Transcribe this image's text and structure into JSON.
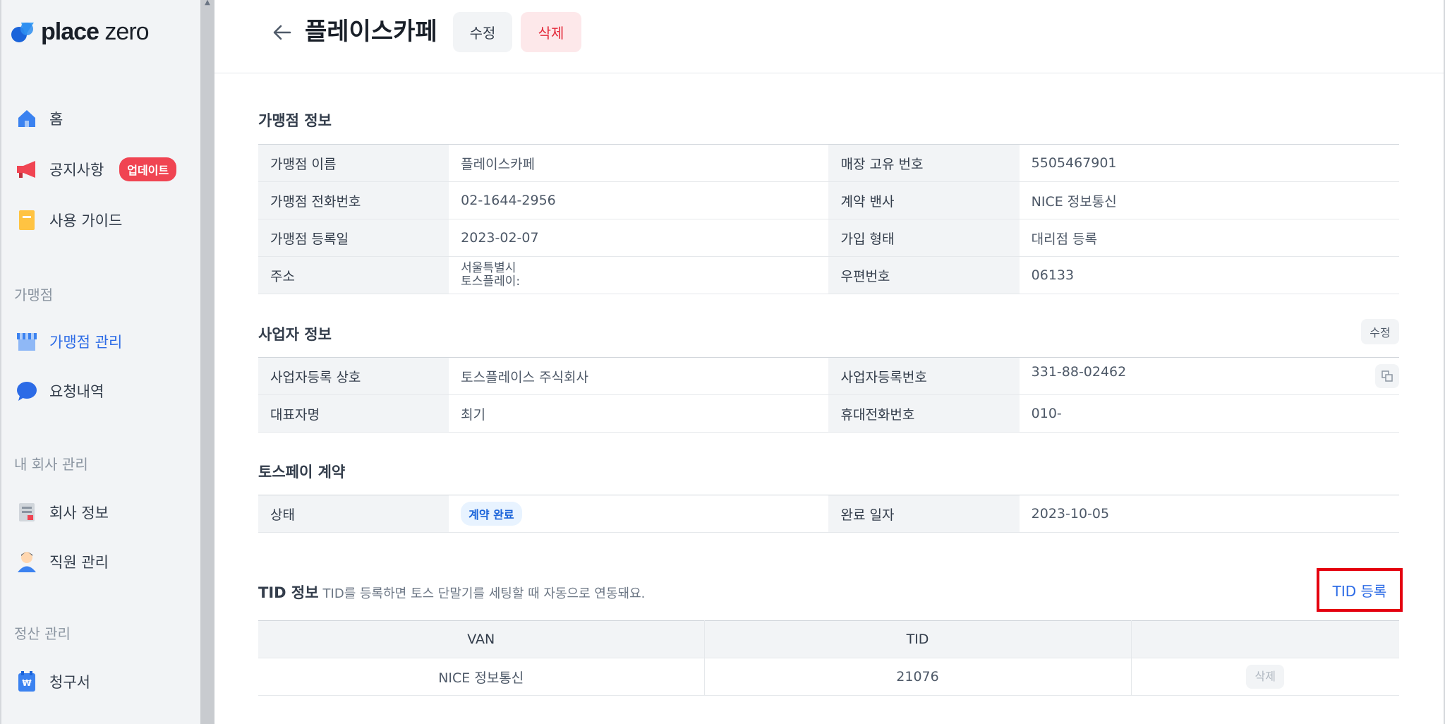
{
  "brand": {
    "logo_bold": "place",
    "logo_light": "zero"
  },
  "sidebar": {
    "items": [
      {
        "label": "홈",
        "icon": "home-icon"
      },
      {
        "label": "공지사항",
        "icon": "megaphone-icon",
        "badge": "업데이트"
      },
      {
        "label": "사용 가이드",
        "icon": "guide-book-icon"
      }
    ],
    "section_franchise": "가맹점",
    "franchise_items": [
      {
        "label": "가맹점 관리",
        "icon": "store-icon",
        "active": true
      },
      {
        "label": "요청내역",
        "icon": "chat-bubble-icon"
      }
    ],
    "section_company": "내 회사 관리",
    "company_items": [
      {
        "label": "회사 정보",
        "icon": "company-doc-icon"
      },
      {
        "label": "직원 관리",
        "icon": "staff-person-icon"
      }
    ],
    "section_settlement": "정산 관리",
    "settlement_items": [
      {
        "label": "청구서",
        "icon": "invoice-icon"
      }
    ]
  },
  "header": {
    "title": "플레이스카페",
    "edit_label": "수정",
    "delete_label": "삭제"
  },
  "store_info": {
    "title": "가맹점 정보",
    "rows": [
      {
        "k1": "가맹점 이름",
        "v1": "플레이스카페",
        "k2": "매장 고유 번호",
        "v2": "5505467901"
      },
      {
        "k1": "가맹점 전화번호",
        "v1": "02-1644-2956",
        "k2": "계약 밴사",
        "v2": "NICE 정보통신"
      },
      {
        "k1": "가맹점 등록일",
        "v1": "2023-02-07",
        "k2": "가입 형태",
        "v2": "대리점 등록"
      },
      {
        "k1": "주소",
        "v1_line1": "서울특별시",
        "v1_line2": "토스플레이:",
        "k2": "우편번호",
        "v2": "06133"
      }
    ]
  },
  "business_info": {
    "title": "사업자 정보",
    "edit_label": "수정",
    "rows": [
      {
        "k1": "사업자등록 상호",
        "v1": "토스플레이스 주식회사",
        "k2": "사업자등록번호",
        "v2": "331-88-02462"
      },
      {
        "k1": "대표자명",
        "v1": "최기",
        "k2": "휴대전화번호",
        "v2": "010-"
      }
    ]
  },
  "tosspay": {
    "title": "토스페이 계약",
    "k1": "상태",
    "status": "계약 완료",
    "k2": "완료 일자",
    "v2": "2023-10-05"
  },
  "tid": {
    "title": "TID 정보",
    "subtitle": "TID를 등록하면 토스 단말기를 세팅할 때 자동으로 연동돼요.",
    "register_label": "TID 등록",
    "columns": [
      "VAN",
      "TID",
      ""
    ],
    "rows": [
      {
        "van": "NICE 정보통신",
        "tid": "21076",
        "action": "삭제"
      }
    ]
  },
  "colors": {
    "accent": "#2c6be6",
    "danger": "#f04452",
    "highlight_box": "#e4000f"
  }
}
